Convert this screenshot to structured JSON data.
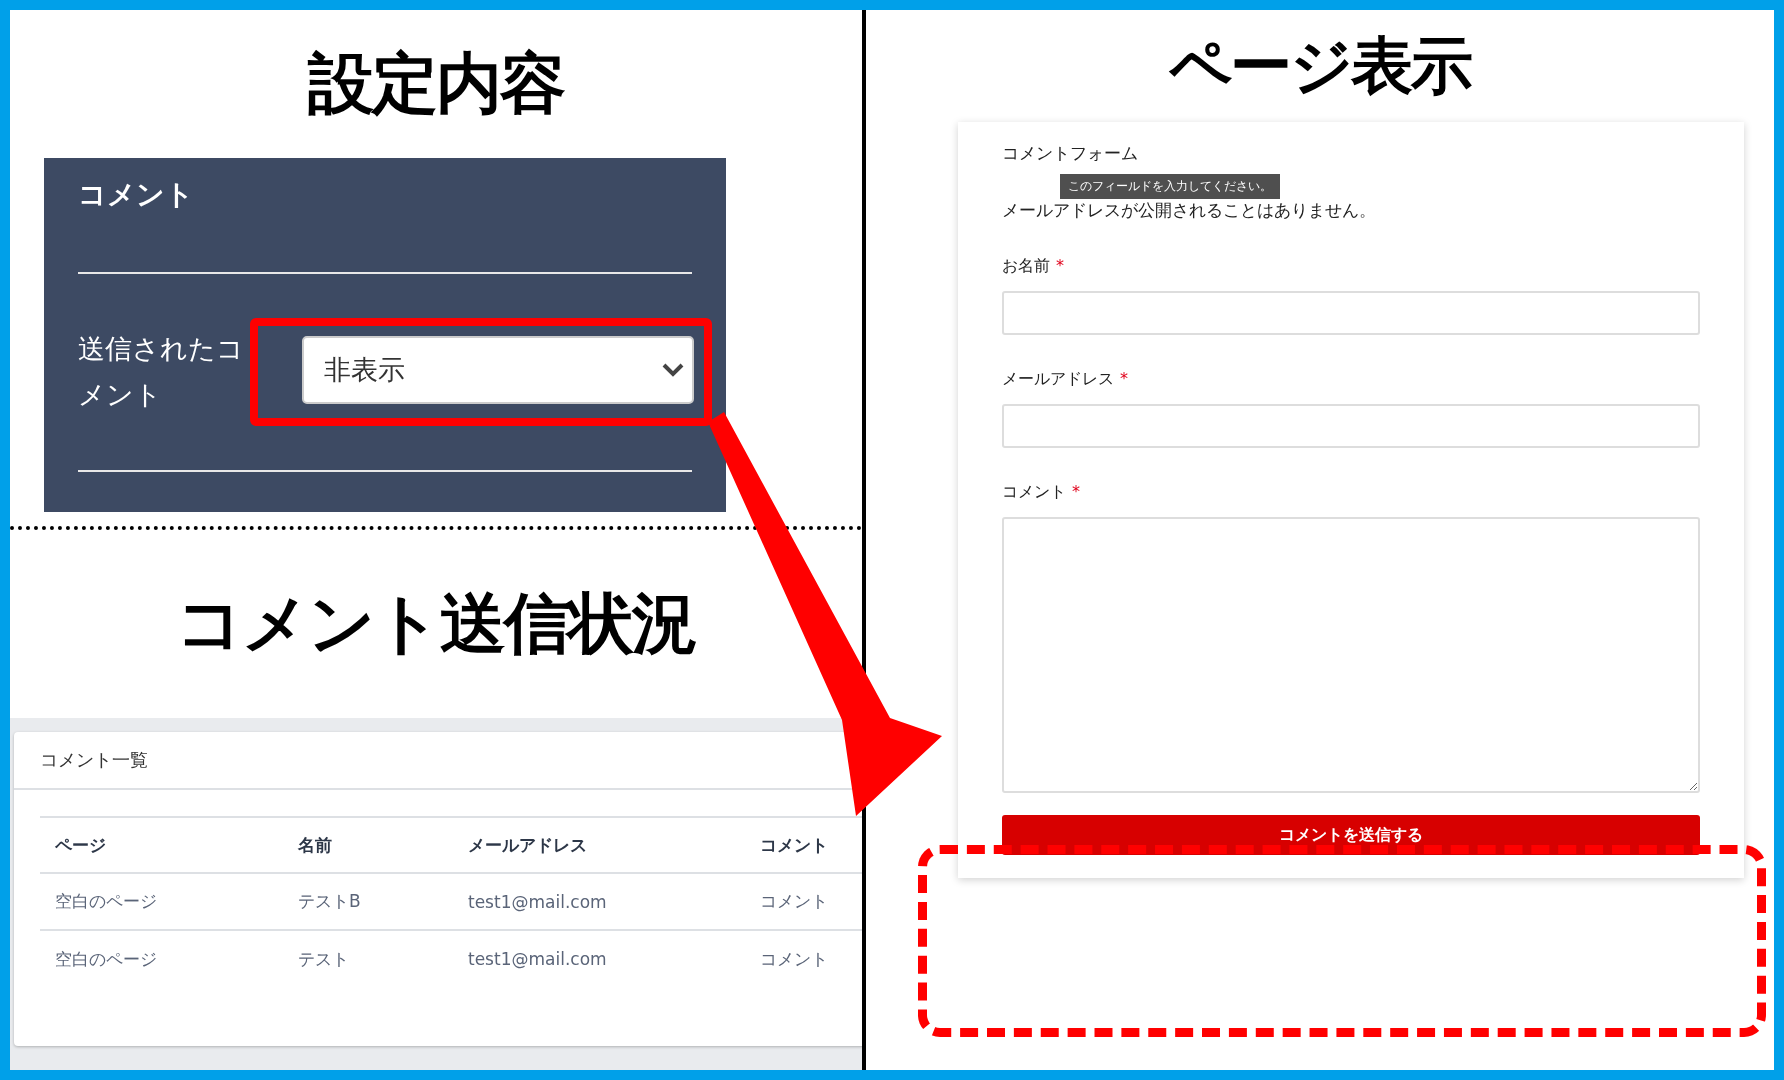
{
  "settings_panel": {
    "title": "設定内容",
    "section_title": "コメント",
    "field_label": "送信されたコメント",
    "select_value": "非表示"
  },
  "comments_panel": {
    "title": "コメント送信状況",
    "card_title": "コメント一覧",
    "columns": [
      "ページ",
      "名前",
      "メールアドレス",
      "コメント"
    ],
    "rows": [
      [
        "空白のページ",
        "テストB",
        "test1@mail.com",
        "コメント"
      ],
      [
        "空白のページ",
        "テスト",
        "test1@mail.com",
        "コメント"
      ]
    ]
  },
  "page_preview": {
    "title": "ページ表示",
    "form_title": "コメントフォーム",
    "tooltip": "このフィールドを入力してください。",
    "notice": "メールアドレスが公開されることはありません。",
    "fields": [
      {
        "label": "お名前",
        "required_mark": "*",
        "kind": "text"
      },
      {
        "label": "メールアドレス",
        "required_mark": "*",
        "kind": "text"
      },
      {
        "label": "コメント",
        "required_mark": "*",
        "kind": "textarea"
      }
    ],
    "submit": "コメントを送信する"
  }
}
